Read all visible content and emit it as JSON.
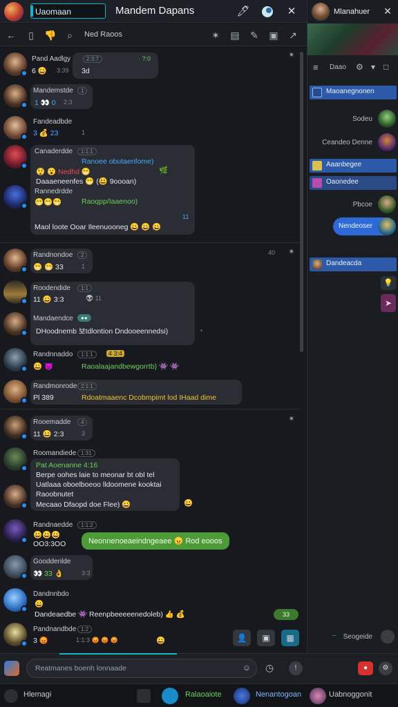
{
  "header": {
    "search_value": "Uaomaan",
    "title": "Mandem Dapans"
  },
  "toolbar": {
    "label": "Ned Raoos"
  },
  "messages": [
    {
      "name": "Pand Aadlgy",
      "pill": "2:3:7",
      "line1": "3d",
      "time": "3:39",
      "reactions": "6 😀",
      "extra": "· ?:0"
    },
    {
      "name": "Mandemstde",
      "pill": "1",
      "line1": "1 👀 0",
      "time": "2:3"
    },
    {
      "name": "Fandeadbde",
      "line1": "3 💰 23",
      "time": "1"
    },
    {
      "name": "Canaderdde",
      "pill": "1:1:1",
      "line1": "😲 😮 Nedhd 😁",
      "line1b": "Ranoee obutaenfome)",
      "line2": "Daaaeneenfes 😁 (😃 9oooan)"
    },
    {
      "name": "Rannedrdde",
      "line1": "😁😁😁",
      "line1b": "Raoqpp/Iaaenoo)",
      "line2": "Maol loote Ooar Ileenuooneg 😀 😀 😀"
    },
    {
      "name": "Randnondoe",
      "pill": "2",
      "line1": "😁 😁 33",
      "time": "1"
    },
    {
      "name": "Roodendide",
      "pill": "1:1",
      "line1": "11 😀 3:3",
      "extra": "👽 11"
    },
    {
      "name": "Mandaendce",
      "pill": "●●",
      "line1": "DHoodnemb 보tdlontion Dndooeennedsi)"
    },
    {
      "name": "Randnnaddo",
      "pill": "1:1:1",
      "tag": "4 3:4",
      "line1": "😀 👿",
      "line1b": "Raoalaajandbewgorrtb) 👾 👾"
    },
    {
      "name": "Randmonrode",
      "pill": "2:1:1",
      "line1": "Pl 389",
      "line1b": "Rdoatmaaenc Dcobmpimt lod IHaad dime"
    },
    {
      "name": "Rooemadde",
      "pill": "4",
      "line1": "11 😀 2:3",
      "time": "3"
    },
    {
      "name": "Roomandiede",
      "pill": "1:31",
      "line1": "Pat Aoenanne 4:16",
      "line2": "Berpe oohes laie to meonar bt obl tel",
      "line3": "Uatlaaa oboelboeoo lldoomene kooktai",
      "line4": "Raoobnutet",
      "line5": "Mecaao Dfaopd doe Flee) 😀"
    },
    {
      "name": "Randnaedde",
      "pill": "1:1:2",
      "line1": "😀😀😀",
      "line2": "OO3:3OO",
      "bubble": "Neonnenoeaeindngeaee 😠 Rod eooos"
    },
    {
      "name": "Gooddenlde",
      "line1": "👀 33 👌",
      "time": "3:3"
    },
    {
      "name": "Dandnnbdo",
      "line1": "😀",
      "line2": "Dandeaedbe 👾 Reenpbeeeeenedoleb) 👍 💰",
      "badge": "33"
    },
    {
      "name": "Pandnandbde",
      "pill": "1:2",
      "line1": "3 😡",
      "time": "1:1:3 😡 😡 😡"
    }
  ],
  "rightpane": {
    "title": "Mlanahuer",
    "tools_label": "Daao",
    "items": [
      {
        "kind": "pill",
        "label": "Maoanegnonen"
      },
      {
        "kind": "row",
        "label": "Sodeu"
      },
      {
        "kind": "row",
        "label": "Ceandeo Denne"
      },
      {
        "kind": "pill",
        "label": "Aaanbegee"
      },
      {
        "kind": "pill",
        "label": "Oaonedee"
      },
      {
        "kind": "row",
        "label": "Pbcoe"
      },
      {
        "kind": "pill",
        "label": "Nendeoser"
      },
      {
        "kind": "pill",
        "label": "Dandeacda"
      },
      {
        "kind": "row",
        "label": "Seogeide"
      }
    ]
  },
  "compose": {
    "placeholder": "Reatmanes boenh lonnaade"
  },
  "statusbar": {
    "item1": "Hlemagi",
    "item2": "Ralaoaiote",
    "item3": "Nenantogoan",
    "item4": "Uabnoggonit"
  },
  "colors": {
    "accent": "#1ab3c8",
    "link": "#4aa8ff",
    "bubble_green": "#4d9a38",
    "selection_blue": "#2d5aa8"
  }
}
